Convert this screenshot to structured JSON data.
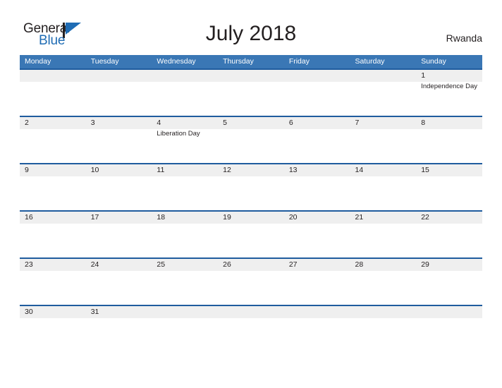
{
  "brand": {
    "name_part1": "General",
    "name_part2": "Blue",
    "triangle_icon": "triangle-right-icon",
    "colors": {
      "dark": "#231f20",
      "blue": "#1f6cb4"
    }
  },
  "header": {
    "title": "July 2018",
    "region": "Rwanda"
  },
  "colors": {
    "header_blue": "#3a77b5",
    "row_divider_blue": "#1f5c9e",
    "daynum_band_gray": "#efefef",
    "text": "#231f20",
    "header_text": "#ffffff"
  },
  "calendar": {
    "weekdays": [
      {
        "label": "Monday"
      },
      {
        "label": "Tuesday"
      },
      {
        "label": "Wednesday"
      },
      {
        "label": "Thursday"
      },
      {
        "label": "Friday"
      },
      {
        "label": "Saturday"
      },
      {
        "label": "Sunday"
      }
    ],
    "weeks": [
      {
        "days": [
          {
            "num": "",
            "event": ""
          },
          {
            "num": "",
            "event": ""
          },
          {
            "num": "",
            "event": ""
          },
          {
            "num": "",
            "event": ""
          },
          {
            "num": "",
            "event": ""
          },
          {
            "num": "",
            "event": ""
          },
          {
            "num": "1",
            "event": "Independence Day"
          }
        ]
      },
      {
        "days": [
          {
            "num": "2",
            "event": ""
          },
          {
            "num": "3",
            "event": ""
          },
          {
            "num": "4",
            "event": "Liberation Day"
          },
          {
            "num": "5",
            "event": ""
          },
          {
            "num": "6",
            "event": ""
          },
          {
            "num": "7",
            "event": ""
          },
          {
            "num": "8",
            "event": ""
          }
        ]
      },
      {
        "days": [
          {
            "num": "9",
            "event": ""
          },
          {
            "num": "10",
            "event": ""
          },
          {
            "num": "11",
            "event": ""
          },
          {
            "num": "12",
            "event": ""
          },
          {
            "num": "13",
            "event": ""
          },
          {
            "num": "14",
            "event": ""
          },
          {
            "num": "15",
            "event": ""
          }
        ]
      },
      {
        "days": [
          {
            "num": "16",
            "event": ""
          },
          {
            "num": "17",
            "event": ""
          },
          {
            "num": "18",
            "event": ""
          },
          {
            "num": "19",
            "event": ""
          },
          {
            "num": "20",
            "event": ""
          },
          {
            "num": "21",
            "event": ""
          },
          {
            "num": "22",
            "event": ""
          }
        ]
      },
      {
        "days": [
          {
            "num": "23",
            "event": ""
          },
          {
            "num": "24",
            "event": ""
          },
          {
            "num": "25",
            "event": ""
          },
          {
            "num": "26",
            "event": ""
          },
          {
            "num": "27",
            "event": ""
          },
          {
            "num": "28",
            "event": ""
          },
          {
            "num": "29",
            "event": ""
          }
        ]
      },
      {
        "days": [
          {
            "num": "30",
            "event": ""
          },
          {
            "num": "31",
            "event": ""
          },
          {
            "num": "",
            "event": ""
          },
          {
            "num": "",
            "event": ""
          },
          {
            "num": "",
            "event": ""
          },
          {
            "num": "",
            "event": ""
          },
          {
            "num": "",
            "event": ""
          }
        ]
      }
    ]
  }
}
